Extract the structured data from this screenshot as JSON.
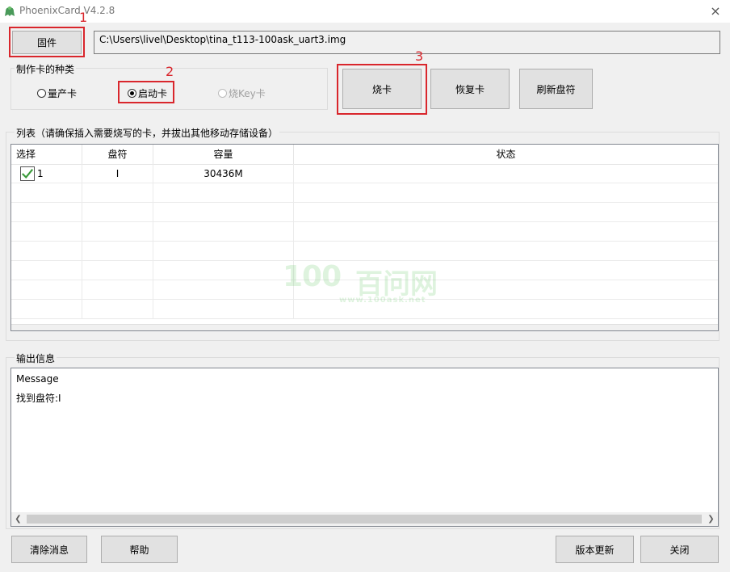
{
  "window": {
    "title": "PhoenixCard V4.2.8",
    "close_icon": "×"
  },
  "firmware": {
    "button_label": "固件",
    "path": "C:\\Users\\livel\\Desktop\\tina_t113-100ask_uart3.img"
  },
  "card_type": {
    "group_label": "制作卡的种类",
    "options": [
      {
        "label": "量产卡",
        "selected": false,
        "disabled": false
      },
      {
        "label": "启动卡",
        "selected": true,
        "disabled": false
      },
      {
        "label": "烧Key卡",
        "selected": false,
        "disabled": true
      }
    ]
  },
  "actions": {
    "burn": "烧卡",
    "restore": "恢复卡",
    "refresh": "刷新盘符"
  },
  "annotations": {
    "n1": "1",
    "n2": "2",
    "n3": "3"
  },
  "list": {
    "group_label": "列表（请确保插入需要烧写的卡，并拔出其他移动存储设备）",
    "columns": [
      "选择",
      "盘符",
      "容量",
      "状态"
    ],
    "rows": [
      {
        "index": "1",
        "checked": true,
        "drive": "I",
        "capacity": "30436M",
        "status": ""
      }
    ]
  },
  "watermark": {
    "num": "100",
    "cn": "百问网",
    "url": "www.100ask.net"
  },
  "output": {
    "group_label": "输出信息",
    "lines": [
      "Message",
      "找到盘符:I"
    ]
  },
  "footer": {
    "clear": "清除消息",
    "help": "帮助",
    "update": "版本更新",
    "close": "关闭"
  },
  "colors": {
    "annotation_red": "#d9262c",
    "check_green": "#3a9a3a"
  }
}
